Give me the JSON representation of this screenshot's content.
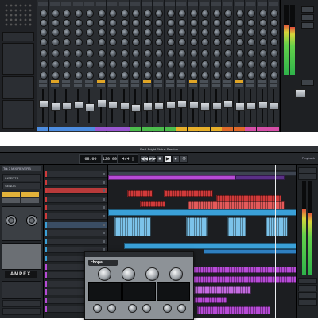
{
  "mixer": {
    "strip_count": 21,
    "channel_colors": [
      "#4d8de0",
      "#4d8de0",
      "#4d8de0",
      "#4d8de0",
      "#4d8de0",
      "#9a57d1",
      "#9a57d1",
      "#9a57d1",
      "#4cbd4c",
      "#4cbd4c",
      "#4cbd4c",
      "#4cbd4c",
      "#e8b02a",
      "#e8b02a",
      "#e8b02a",
      "#e8b02a",
      "#e06a2a",
      "#e06a2a",
      "#d64fa8",
      "#d64fa8",
      "#d64fa8"
    ],
    "fader_levels": [
      0.62,
      0.55,
      0.58,
      0.6,
      0.52,
      0.66,
      0.6,
      0.58,
      0.5,
      0.55,
      0.57,
      0.61,
      0.63,
      0.6,
      0.56,
      0.59,
      0.62,
      0.54,
      0.58,
      0.6,
      0.57
    ],
    "master_meter_levels": [
      0.72,
      0.68
    ]
  },
  "daw": {
    "window_title": "Real-Bright Status Session",
    "transport": {
      "time_display": "08:00",
      "tempo_display": "120.00",
      "signature_display": "4/4 | TIME",
      "buttons": [
        "◀◀",
        "▶▶",
        "■",
        "▶",
        "●",
        "⟲"
      ]
    },
    "top_right_label": "Playback",
    "inspector": {
      "header": "Trk 7 MIX REVERB",
      "rows": [
        "INSERTS",
        "SENDS"
      ],
      "plugin_name": "AMPEX"
    },
    "tracks": [
      {
        "name": "",
        "color": "#cf3a3a"
      },
      {
        "name": "",
        "color": "#cf3a3a"
      },
      {
        "name": "",
        "color": "#cf3a3a"
      },
      {
        "name": "",
        "color": "#cf3a3a"
      },
      {
        "name": "",
        "color": "#cf3a3a"
      },
      {
        "name": "",
        "color": "#cf3a3a"
      },
      {
        "name": "",
        "color": "#3aa0d8"
      },
      {
        "name": "",
        "color": "#3aa0d8"
      },
      {
        "name": "",
        "color": "#3aa0d8"
      },
      {
        "name": "",
        "color": "#3aa0d8"
      },
      {
        "name": "",
        "color": "#3aa0d8"
      },
      {
        "name": "",
        "color": "#b64ad6"
      },
      {
        "name": "",
        "color": "#b64ad6"
      },
      {
        "name": "",
        "color": "#b64ad6"
      },
      {
        "name": "",
        "color": "#b64ad6"
      },
      {
        "name": "",
        "color": "#b64ad6"
      },
      {
        "name": "",
        "color": "#b64ad6"
      }
    ],
    "plugin_window": {
      "title": "",
      "logo": "chopa"
    },
    "right_panel_buttons": [
      "",
      "",
      "",
      "",
      "",
      ""
    ]
  }
}
